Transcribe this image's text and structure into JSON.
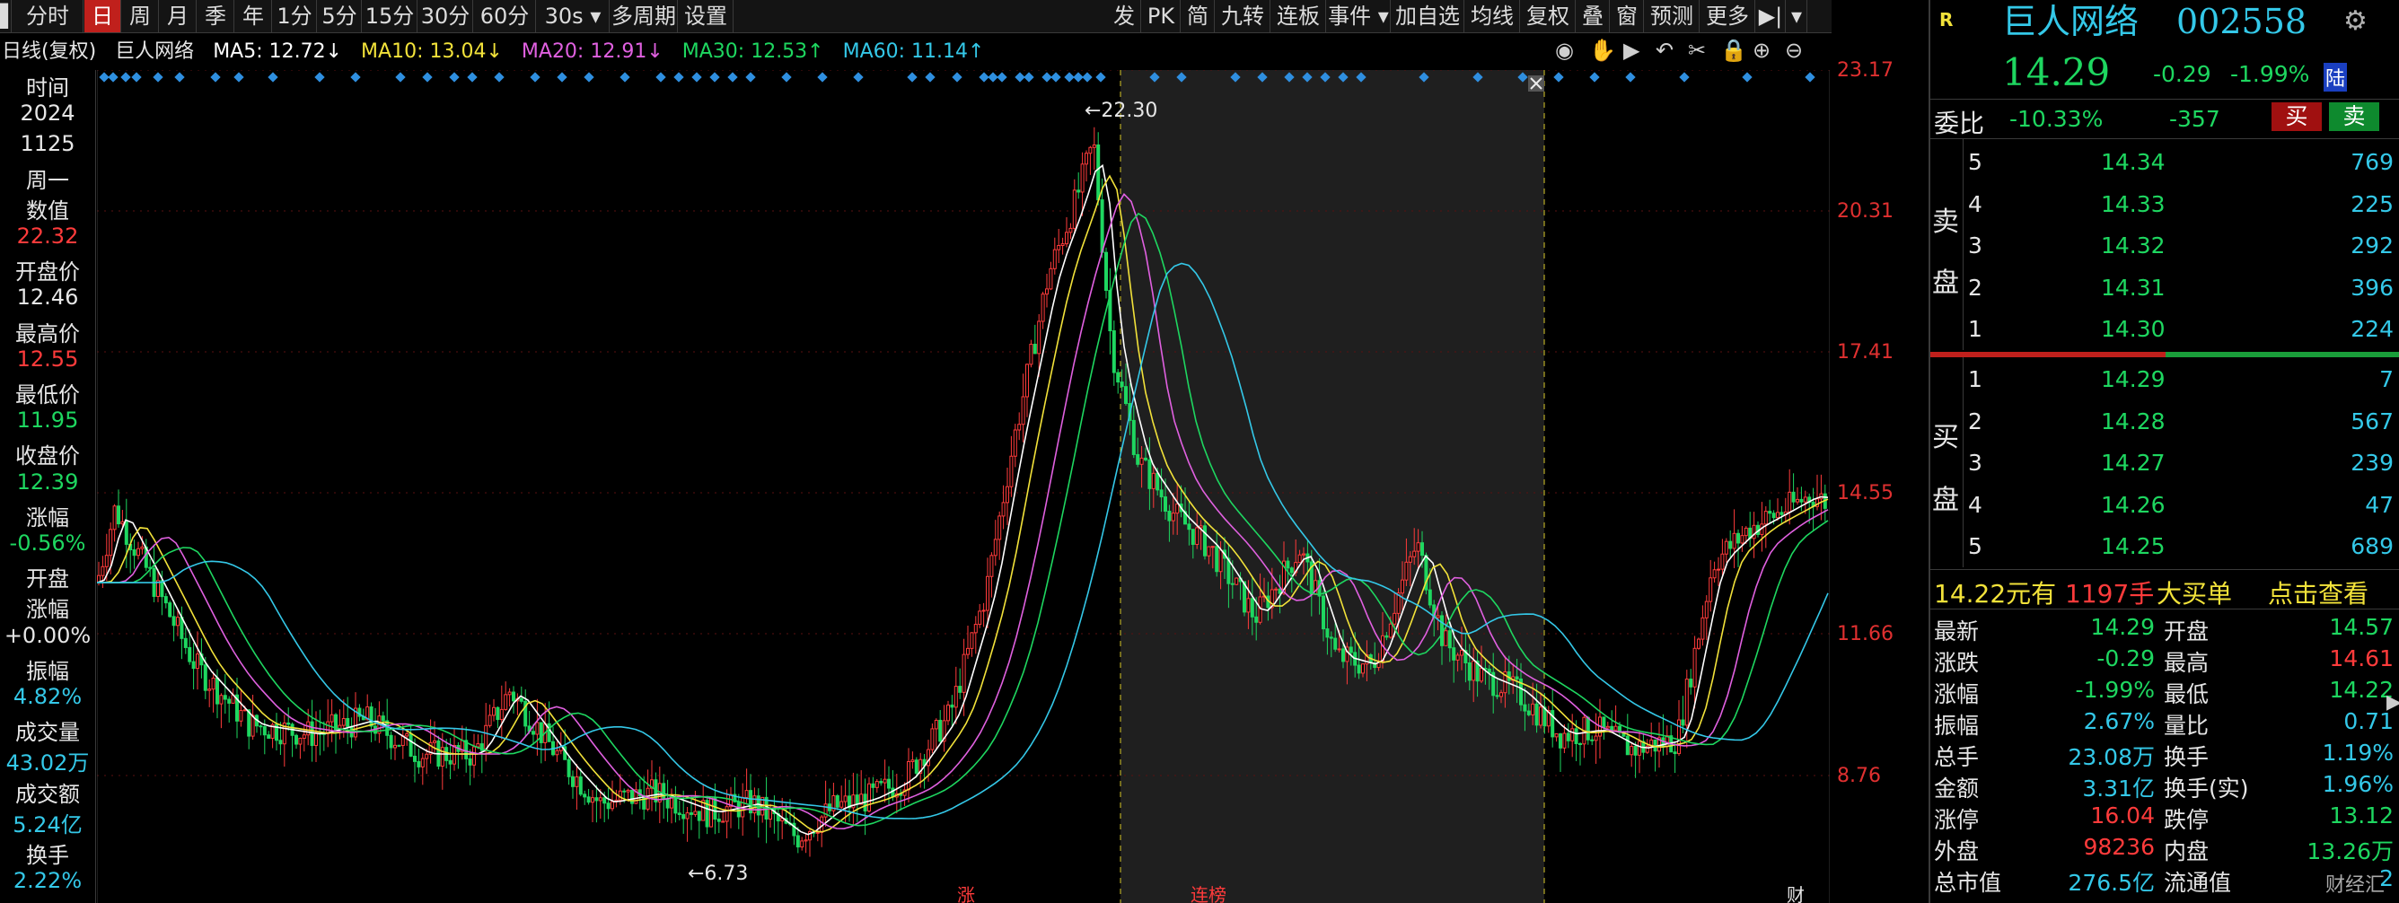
{
  "toolbar": {
    "left": [
      "分时",
      "日",
      "周",
      "月",
      "季",
      "年",
      "1分",
      "5分",
      "15分",
      "30分",
      "60分",
      "30s",
      "多周期",
      "设置"
    ],
    "right": [
      "发",
      "PK",
      "简",
      "九转",
      "连板",
      "事件",
      "加自选",
      "均线",
      "复权",
      "叠",
      "窗",
      "预测",
      "更多"
    ]
  },
  "ma": {
    "type": "日线(复权)",
    "name": "巨人网络",
    "ma5": "MA5: 12.72↓",
    "ma10": "MA10: 13.04↓",
    "ma20": "MA20: 12.91↓",
    "ma30": "MA30: 12.53↑",
    "ma60": "MA60: 11.14↑"
  },
  "left_panel": [
    {
      "t": "时间",
      "c": "white"
    },
    {
      "t": "2024",
      "c": "white"
    },
    {
      "t": "1125",
      "c": "white"
    },
    {
      "t": "周一",
      "c": "white"
    },
    {
      "t": "数值",
      "c": "white"
    },
    {
      "t": "22.32",
      "c": "red"
    },
    {
      "t": "开盘价",
      "c": "white"
    },
    {
      "t": "12.46",
      "c": "white"
    },
    {
      "t": "最高价",
      "c": "white"
    },
    {
      "t": "12.55",
      "c": "red"
    },
    {
      "t": "最低价",
      "c": "white"
    },
    {
      "t": "11.95",
      "c": "green"
    },
    {
      "t": "收盘价",
      "c": "white"
    },
    {
      "t": "12.39",
      "c": "green"
    },
    {
      "t": "涨幅",
      "c": "white"
    },
    {
      "t": "-0.56%",
      "c": "green"
    },
    {
      "t": "开盘",
      "c": "white"
    },
    {
      "t": "涨幅",
      "c": "white"
    },
    {
      "t": "+0.00%",
      "c": "white"
    },
    {
      "t": "振幅",
      "c": "white"
    },
    {
      "t": "4.82%",
      "c": "cyan"
    },
    {
      "t": "成交量",
      "c": "white"
    },
    {
      "t": "43.02万",
      "c": "cyan"
    },
    {
      "t": "成交额",
      "c": "white"
    },
    {
      "t": "5.24亿",
      "c": "cyan"
    },
    {
      "t": "换手",
      "c": "white"
    },
    {
      "t": "2.22%",
      "c": "cyan"
    }
  ],
  "yaxis": [
    "23.17",
    "20.31",
    "17.41",
    "14.55",
    "11.66",
    "8.76"
  ],
  "annotations": {
    "high": "22.30",
    "low": "6.73"
  },
  "bottom_marks": [
    "涨",
    "连榜",
    "财"
  ],
  "stock": {
    "name": "巨人网络",
    "code": "002558",
    "price": "14.29",
    "change": "-0.29",
    "pct": "-1.99%",
    "badge": "陆",
    "r": "R"
  },
  "weibi": {
    "label": "委比",
    "pct": "-10.33%",
    "diff": "-357",
    "buy": "买",
    "sell": "卖"
  },
  "sell_label": [
    "卖",
    "盘"
  ],
  "buy_label": [
    "买",
    "盘"
  ],
  "sell": [
    {
      "lv": "5",
      "p": "14.34",
      "v": "769"
    },
    {
      "lv": "4",
      "p": "14.33",
      "v": "225"
    },
    {
      "lv": "3",
      "p": "14.32",
      "v": "292"
    },
    {
      "lv": "2",
      "p": "14.31",
      "v": "396"
    },
    {
      "lv": "1",
      "p": "14.30",
      "v": "224"
    }
  ],
  "buy": [
    {
      "lv": "1",
      "p": "14.29",
      "v": "7"
    },
    {
      "lv": "2",
      "p": "14.28",
      "v": "567"
    },
    {
      "lv": "3",
      "p": "14.27",
      "v": "239"
    },
    {
      "lv": "4",
      "p": "14.26",
      "v": "47"
    },
    {
      "lv": "5",
      "p": "14.25",
      "v": "689"
    }
  ],
  "bigbuy": {
    "price": "14.22元有",
    "qty": "1197手",
    "label": "大买单",
    "link": "点击查看"
  },
  "stats": [
    {
      "k1": "最新",
      "v1": "14.29",
      "c1": "green",
      "k2": "开盘",
      "v2": "14.57",
      "c2": "green"
    },
    {
      "k1": "涨跌",
      "v1": "-0.29",
      "c1": "green",
      "k2": "最高",
      "v2": "14.61",
      "c2": "red"
    },
    {
      "k1": "涨幅",
      "v1": "-1.99%",
      "c1": "green",
      "k2": "最低",
      "v2": "14.22",
      "c2": "green"
    },
    {
      "k1": "振幅",
      "v1": "2.67%",
      "c1": "cyan",
      "k2": "量比",
      "v2": "0.71",
      "c2": "cyan"
    },
    {
      "k1": "总手",
      "v1": "23.08万",
      "c1": "cyan",
      "k2": "换手",
      "v2": "1.19%",
      "c2": "cyan"
    },
    {
      "k1": "金额",
      "v1": "3.31亿",
      "c1": "cyan",
      "k2": "换手(实)",
      "v2": "1.96%",
      "c2": "cyan"
    },
    {
      "k1": "涨停",
      "v1": "16.04",
      "c1": "red",
      "k2": "跌停",
      "v2": "13.12",
      "c2": "green"
    },
    {
      "k1": "外盘",
      "v1": "98236",
      "c1": "red",
      "k2": "内盘",
      "v2": "13.26万",
      "c2": "green"
    },
    {
      "k1": "总市值",
      "v1": "276.5亿",
      "c1": "cyan",
      "k2": "流通值",
      "v2": "2",
      "c2": "cyan"
    }
  ],
  "watermark": "财经汇",
  "colors": {
    "up": "#ff3b3b",
    "down": "#1ed760",
    "ma5": "#ffffff",
    "ma10": "#f2e23a",
    "ma20": "#e060e0",
    "ma30": "#1ed760",
    "ma60": "#34c8e8",
    "bg": "#000000"
  }
}
